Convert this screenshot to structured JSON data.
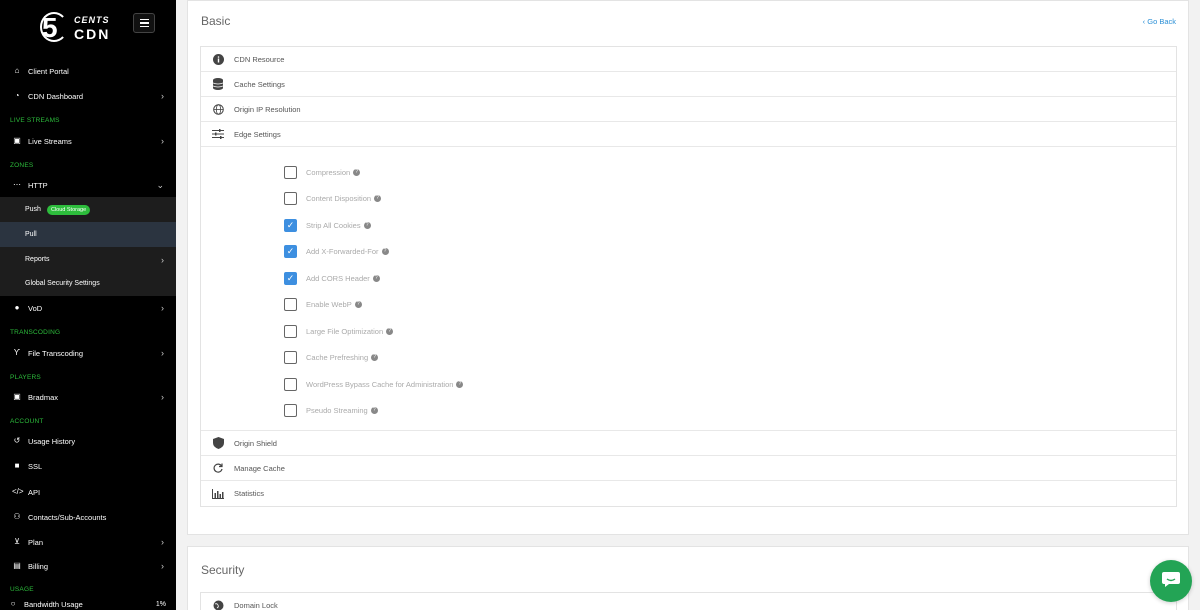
{
  "logo": {
    "five": "5",
    "cents": "CENTS",
    "cdn": "CDN"
  },
  "nav": {
    "client_portal": "Client Portal",
    "cdn_dashboard": "CDN Dashboard",
    "sec_live": "LIVE STREAMS",
    "live_streams": "Live Streams",
    "sec_zones": "ZONES",
    "http": "HTTP",
    "push": "Push",
    "push_badge": "Cloud Storage",
    "pull": "Pull",
    "reports": "Reports",
    "global_security": "Global Security Settings",
    "vod": "VoD",
    "sec_transcoding": "TRANSCODING",
    "file_transcoding": "File Transcoding",
    "sec_players": "PLAYERS",
    "bradmax": "Bradmax",
    "sec_account": "ACCOUNT",
    "usage_history": "Usage History",
    "ssl": "SSL",
    "api": "API",
    "contacts": "Contacts/Sub-Accounts",
    "plan": "Plan",
    "billing": "Billing",
    "sec_usage": "USAGE",
    "bandwidth_usage": "Bandwidth Usage",
    "bandwidth_pct": "1%"
  },
  "basic": {
    "title": "Basic",
    "go_back": "Go Back",
    "sections": {
      "cdn_resource": "CDN Resource",
      "cache_settings": "Cache Settings",
      "origin_ip": "Origin IP Resolution",
      "edge_settings": "Edge Settings",
      "origin_shield": "Origin Shield",
      "manage_cache": "Manage Cache",
      "statistics": "Statistics"
    },
    "options": [
      {
        "label": "Compression",
        "checked": false
      },
      {
        "label": "Content Disposition",
        "checked": false
      },
      {
        "label": "Strip All Cookies",
        "checked": true
      },
      {
        "label": "Add X-Forwarded-For",
        "checked": true
      },
      {
        "label": "Add CORS Header",
        "checked": true
      },
      {
        "label": "Enable WebP",
        "checked": false
      },
      {
        "label": "Large File Optimization",
        "checked": false
      },
      {
        "label": "Cache Prefreshing",
        "checked": false
      },
      {
        "label": "WordPress Bypass Cache for Administration",
        "checked": false
      },
      {
        "label": "Pseudo Streaming",
        "checked": false
      }
    ]
  },
  "security": {
    "title": "Security",
    "domain_lock": "Domain Lock"
  },
  "colors": {
    "accent_green": "#2dbd3c",
    "link_blue": "#2a8fd6",
    "checkbox_blue": "#3d8fe0",
    "chat_green": "#23a455"
  }
}
